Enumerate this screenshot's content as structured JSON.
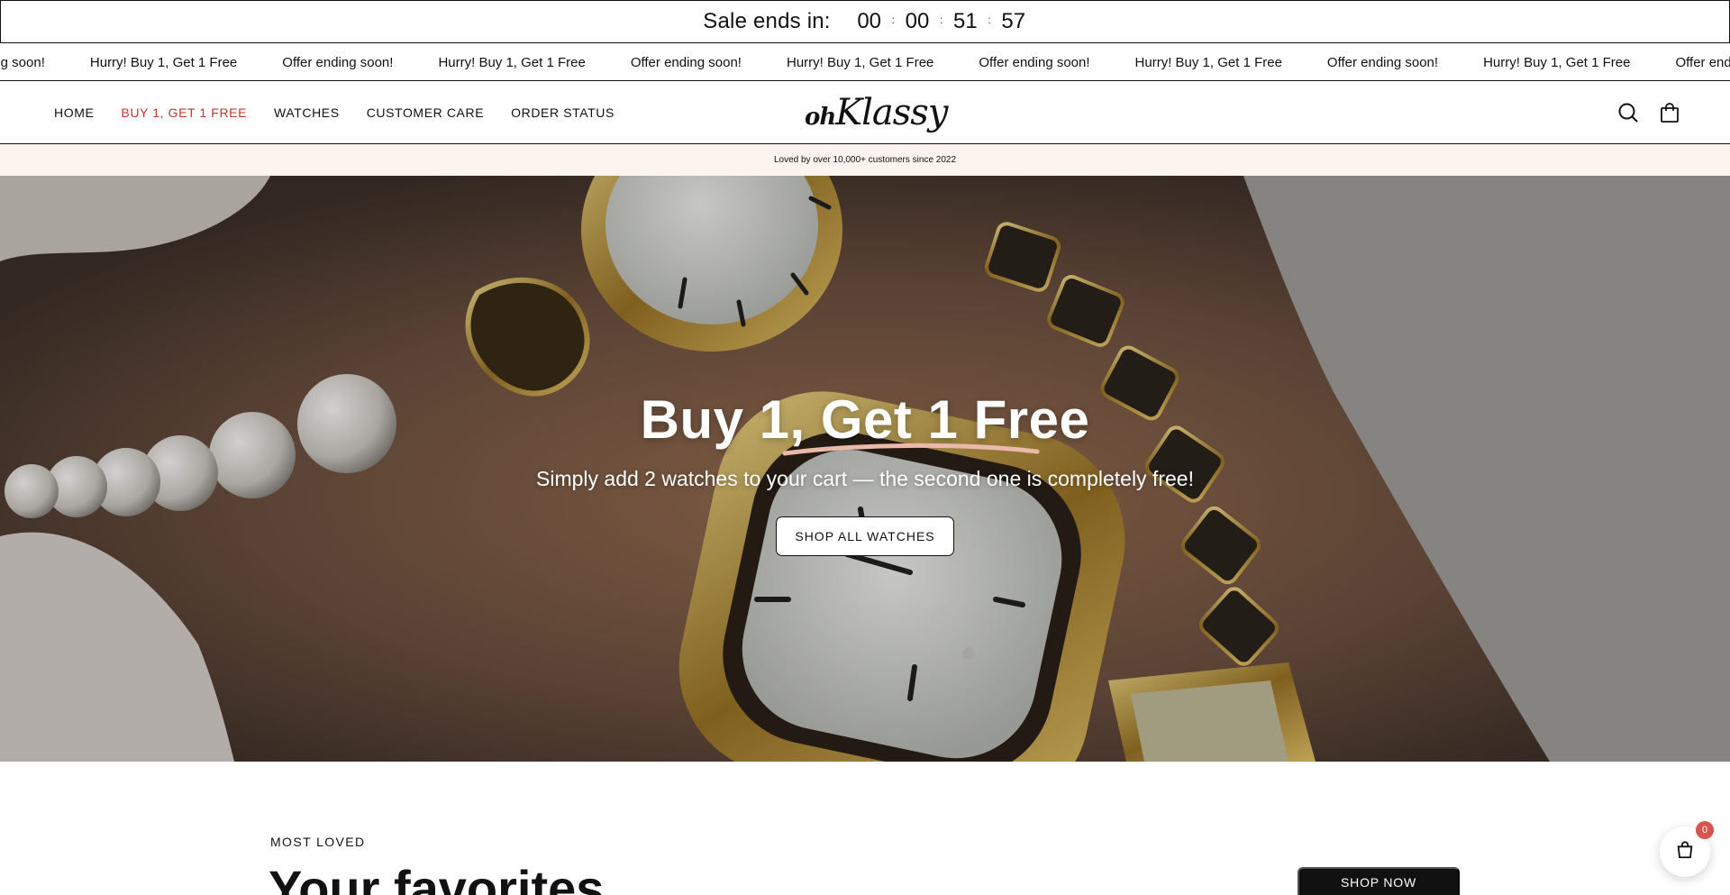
{
  "countdown": {
    "label": "Sale ends in:",
    "days": "00",
    "hours": "00",
    "minutes": "51",
    "seconds": "57",
    "separator": ":"
  },
  "marquee": {
    "items": [
      "ing soon!",
      "Hurry! Buy 1, Get 1 Free",
      "Offer ending soon!",
      "Hurry! Buy 1, Get 1 Free",
      "Offer ending soon!",
      "Hurry! Buy 1, Get 1 Free",
      "Offer ending soon!",
      "Hurry! Buy 1, Get 1 Free",
      "Offer ending soon!",
      "Hurry! Buy 1, Get 1 Free",
      "Offer ending soon!"
    ]
  },
  "header": {
    "nav": [
      {
        "label": "HOME",
        "active": false
      },
      {
        "label": "BUY 1, GET 1 FREE",
        "active": true,
        "color": "#c0392b"
      },
      {
        "label": "WATCHES",
        "active": false
      },
      {
        "label": "CUSTOMER CARE",
        "active": false
      },
      {
        "label": "ORDER STATUS",
        "active": false
      }
    ],
    "logo": {
      "prefix": "oh",
      "name": "Klassy"
    },
    "icons": [
      "search-icon",
      "shopping-bag-icon"
    ]
  },
  "announcement": "Loved by over 10,000+ customers since 2022",
  "hero": {
    "title": "Buy 1, Get 1 Free",
    "subtitle": "Simply add 2 watches to your cart — the second one is completely free!",
    "button": "SHOP ALL WATCHES",
    "underline_color": "#e9b9a9"
  },
  "section": {
    "eyebrow": "MOST LOVED",
    "title": "Your favorites",
    "button": "SHOP NOW"
  },
  "floating_cart": {
    "icon": "shopping-bag-icon",
    "count": "0",
    "badge_color": "#d9534f"
  }
}
